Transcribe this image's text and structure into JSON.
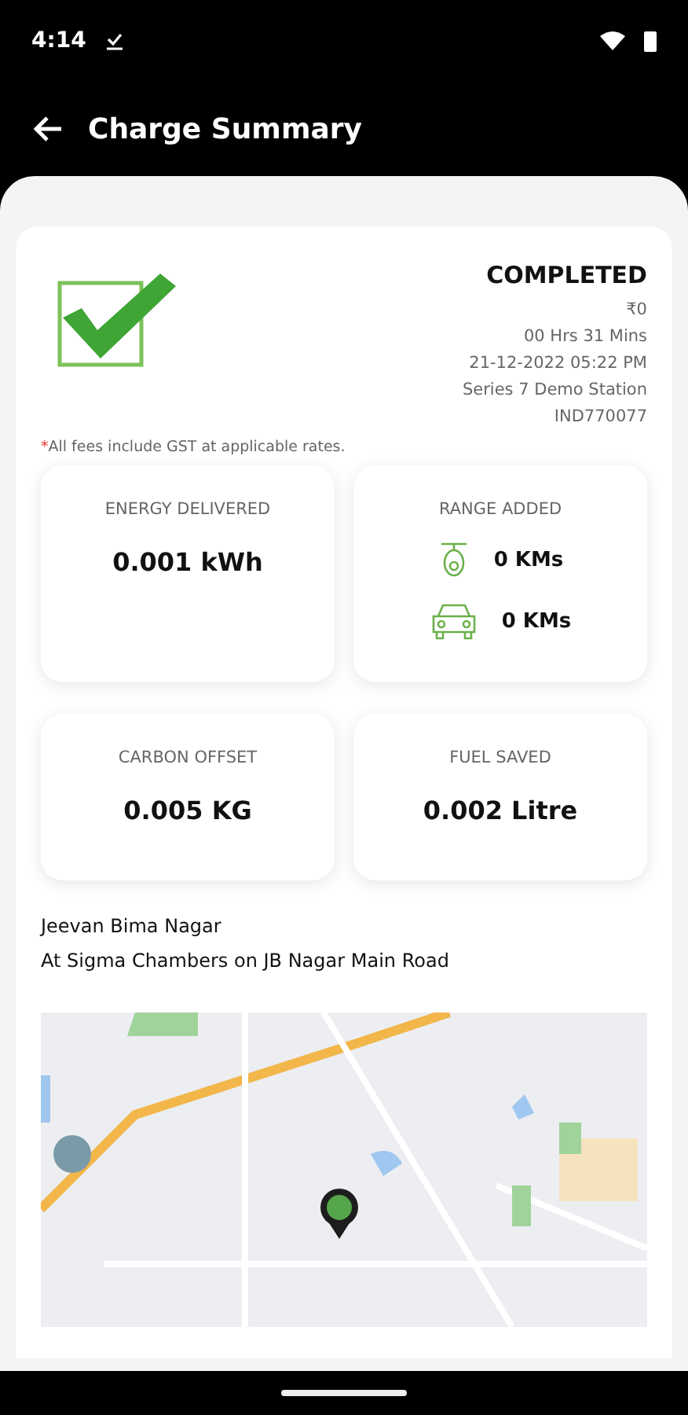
{
  "status_bar": {
    "time": "4:14"
  },
  "header": {
    "title": "Charge Summary"
  },
  "summary": {
    "status": "COMPLETED",
    "details": [
      "₹0",
      "00 Hrs 31 Mins",
      "21-12-2022 05:22 PM",
      "Series 7 Demo Station",
      "IND770077"
    ],
    "note_mark": "*",
    "note": "All fees include GST at applicable rates."
  },
  "metrics": [
    {
      "kind": "value",
      "label": "ENERGY DELIVERED",
      "value": "0.001 kWh"
    },
    {
      "kind": "range",
      "label": "RANGE ADDED",
      "rows": [
        {
          "kind": "scooter",
          "value": "0 KMs"
        },
        {
          "kind": "car",
          "value": "0 KMs"
        }
      ]
    },
    {
      "kind": "value",
      "label": "CARBON OFFSET",
      "value": "0.005 KG"
    },
    {
      "kind": "value",
      "label": "FUEL SAVED",
      "value": "0.002 Litre"
    }
  ],
  "location": {
    "name": "Jeevan Bima Nagar",
    "address": "At Sigma Chambers on JB Nagar Main Road"
  }
}
